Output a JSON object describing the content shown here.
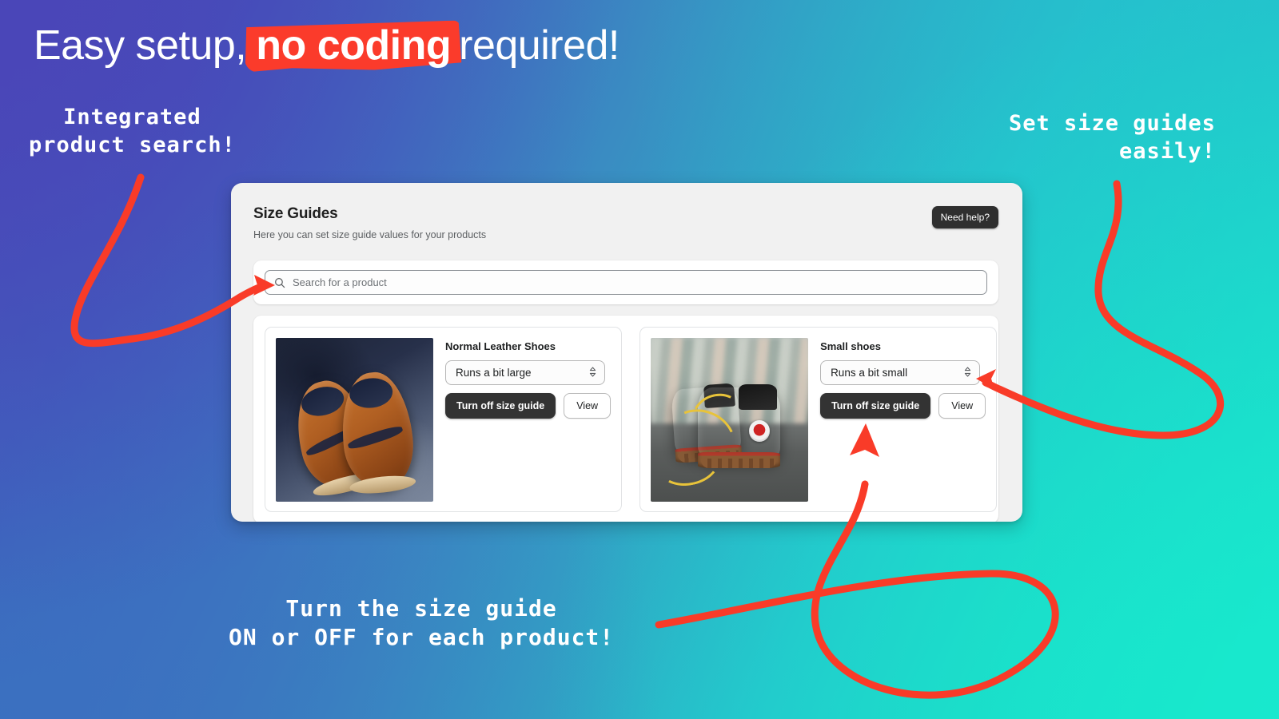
{
  "headline": {
    "before": "Easy setup,",
    "highlight": "no coding",
    "after": "required!"
  },
  "annotations": {
    "left": "Integrated\nproduct search!",
    "right": "Set size guides\neasily!",
    "bottom": "Turn the size guide\nON or OFF for each product!"
  },
  "app": {
    "title": "Size Guides",
    "subtitle": "Here you can set size guide values for your products",
    "need_help_label": "Need help?",
    "search": {
      "placeholder": "Search for a product",
      "value": "",
      "icon": "search-icon"
    },
    "products": [
      {
        "name": "Normal Leather Shoes",
        "fit_value": "Runs a bit large",
        "primary_label": "Turn off size guide",
        "secondary_label": "View",
        "image_alt": "brown leather oxford shoes on dark blue fabric"
      },
      {
        "name": "Small shoes",
        "fit_value": "Runs a bit small",
        "primary_label": "Turn off size guide",
        "secondary_label": "View",
        "image_alt": "tan toddler work boots with yellow laces"
      }
    ]
  },
  "colors": {
    "accent_red": "#f93b28",
    "gradient_start": "#4a46b8",
    "gradient_end": "#14ecd0",
    "button_dark": "#333333"
  }
}
